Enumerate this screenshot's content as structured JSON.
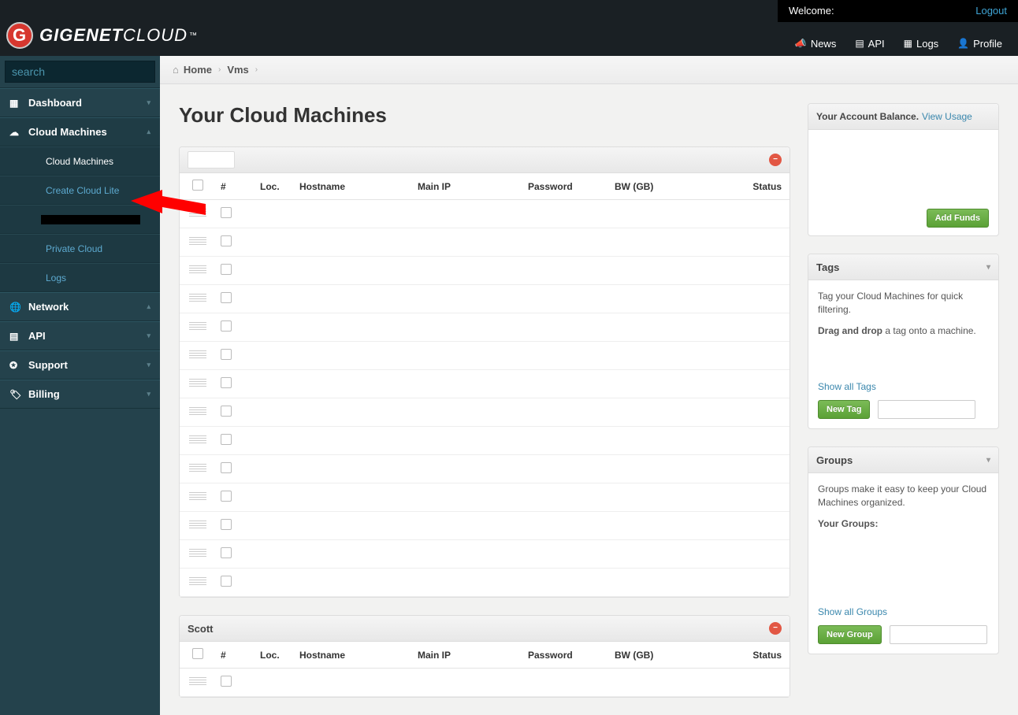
{
  "topbar": {
    "welcome": "Welcome:",
    "logout": "Logout",
    "brand1": "GIGENET",
    "brand2": "CLOUD",
    "nav": {
      "news": "News",
      "api": "API",
      "logs": "Logs",
      "profile": "Profile"
    }
  },
  "search": {
    "placeholder": "search"
  },
  "sidebar": {
    "dashboard": "Dashboard",
    "cloud_machines": "Cloud Machines",
    "network": "Network",
    "api": "API",
    "support": "Support",
    "billing": "Billing",
    "sub": {
      "cloud_machines": "Cloud Machines",
      "create_cloud_lite": "Create Cloud Lite",
      "private_cloud": "Private Cloud",
      "logs": "Logs"
    }
  },
  "breadcrumb": {
    "home": "Home",
    "vms": "Vms"
  },
  "page_title": "Your Cloud Machines",
  "table": {
    "headers": {
      "num": "#",
      "loc": "Loc.",
      "hostname": "Hostname",
      "main_ip": "Main IP",
      "password": "Password",
      "bw": "BW (GB)",
      "status": "Status"
    }
  },
  "group1_name": "",
  "group2_name": "Scott",
  "account": {
    "balance_label": "Your Account Balance.",
    "view_usage": "View Usage",
    "add_funds": "Add Funds"
  },
  "tags": {
    "title": "Tags",
    "desc": "Tag your Cloud Machines for quick filtering.",
    "drag_bold": "Drag and drop",
    "drag_rest": " a tag onto a machine.",
    "show_all": "Show all Tags",
    "new_tag": "New Tag"
  },
  "groups": {
    "title": "Groups",
    "desc": "Groups make it easy to keep your Cloud Machines organized.",
    "your_groups": "Your Groups:",
    "show_all": "Show all Groups",
    "new_group": "New Group"
  }
}
